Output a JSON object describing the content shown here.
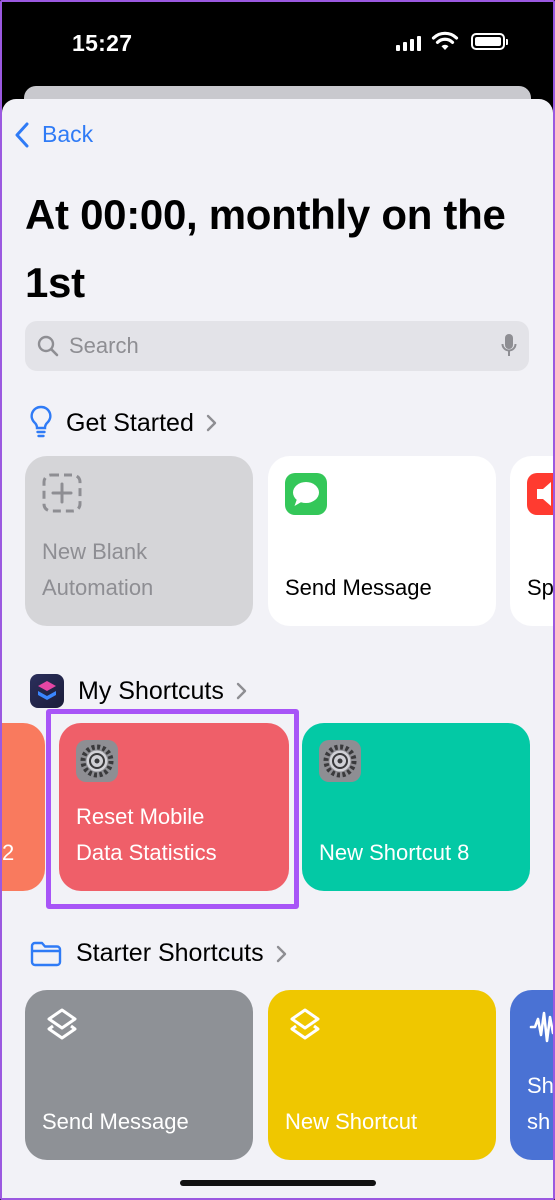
{
  "status": {
    "time": "15:27"
  },
  "nav": {
    "back_label": "Back"
  },
  "title": "At 00:00, monthly on the 1st",
  "search": {
    "placeholder": "Search"
  },
  "sections": {
    "get_started": {
      "title": "Get Started",
      "cards": [
        {
          "label": "New Blank\nAutomation",
          "color": "#d5d5d8",
          "text_color": "#8e8e93"
        },
        {
          "label": "Send Message",
          "color": "#ffffff",
          "text_color": "#000000"
        },
        {
          "label": "Sp",
          "color": "#ffffff",
          "text_color": "#000000"
        }
      ]
    },
    "my_shortcuts": {
      "title": "My Shortcuts",
      "cards": [
        {
          "label": "2",
          "color": "#f97a5e"
        },
        {
          "label": "Reset Mobile\nData Statistics",
          "color": "#ef5f69"
        },
        {
          "label": "New Shortcut 8",
          "color": "#03c9a5"
        }
      ]
    },
    "starter_shortcuts": {
      "title": "Starter Shortcuts",
      "cards": [
        {
          "label": "Send Message",
          "color": "#8e9196"
        },
        {
          "label": "New Shortcut",
          "color": "#efc700"
        },
        {
          "label": "Sh\nsh",
          "color": "#4a72d4"
        }
      ]
    }
  },
  "colors": {
    "accent": "#2f7bf6",
    "highlight": "#a855f7"
  }
}
